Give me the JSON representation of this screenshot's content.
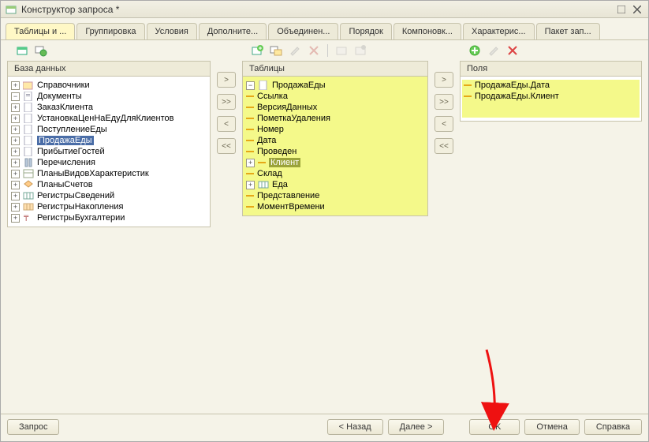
{
  "window": {
    "title": "Конструктор запроса *"
  },
  "tabs": [
    "Таблицы и ...",
    "Группировка",
    "Условия",
    "Дополните...",
    "Объединен...",
    "Порядок",
    "Компоновк...",
    "Характерис...",
    "Пакет зап..."
  ],
  "active_tab": 0,
  "panels": {
    "db": "База данных",
    "tables": "Таблицы",
    "fields": "Поля"
  },
  "db_tree": [
    {
      "label": "Справочники",
      "exp": "+",
      "icon": "catalog"
    },
    {
      "label": "Документы",
      "exp": "-",
      "icon": "document",
      "children": [
        {
          "label": "ЗаказКлиента",
          "exp": "+",
          "icon": "doc"
        },
        {
          "label": "УстановкаЦенНаЕдуДляКлиентов",
          "exp": "+",
          "icon": "doc"
        },
        {
          "label": "ПоступлениеЕды",
          "exp": "+",
          "icon": "doc"
        },
        {
          "label": "ПродажаЕды",
          "exp": "+",
          "icon": "doc",
          "selected": true
        },
        {
          "label": "ПрибытиеГостей",
          "exp": "+",
          "icon": "doc"
        }
      ]
    },
    {
      "label": "Перечисления",
      "exp": "+",
      "icon": "enum"
    },
    {
      "label": "ПланыВидовХарактеристик",
      "exp": "+",
      "icon": "charttype"
    },
    {
      "label": "ПланыСчетов",
      "exp": "+",
      "icon": "accounts"
    },
    {
      "label": "РегистрыСведений",
      "exp": "+",
      "icon": "inforeg"
    },
    {
      "label": "РегистрыНакопления",
      "exp": "+",
      "icon": "accreg"
    },
    {
      "label": "РегистрыБухгалтерии",
      "exp": "+",
      "icon": "bookreg"
    }
  ],
  "tables_tree": {
    "root": "ПродажаЕды",
    "root_exp": "-",
    "children": [
      {
        "label": "Ссылка"
      },
      {
        "label": "ВерсияДанных"
      },
      {
        "label": "ПометкаУдаления"
      },
      {
        "label": "Номер"
      },
      {
        "label": "Дата"
      },
      {
        "label": "Проведен"
      },
      {
        "label": "Клиент",
        "exp": "+",
        "selected": true
      },
      {
        "label": "Склад"
      },
      {
        "label": "Еда",
        "exp": "+",
        "icon": "table"
      },
      {
        "label": "Представление"
      },
      {
        "label": "МоментВремени"
      }
    ]
  },
  "fields": [
    "ПродажаЕды.Дата",
    "ПродажаЕды.Клиент"
  ],
  "footer": {
    "query": "Запрос",
    "back": "< Назад",
    "next": "Далее >",
    "ok": "OK",
    "cancel": "Отмена",
    "help": "Справка"
  },
  "colors": {
    "highlight": "#f4f98a",
    "selection": "#4a6da7"
  }
}
